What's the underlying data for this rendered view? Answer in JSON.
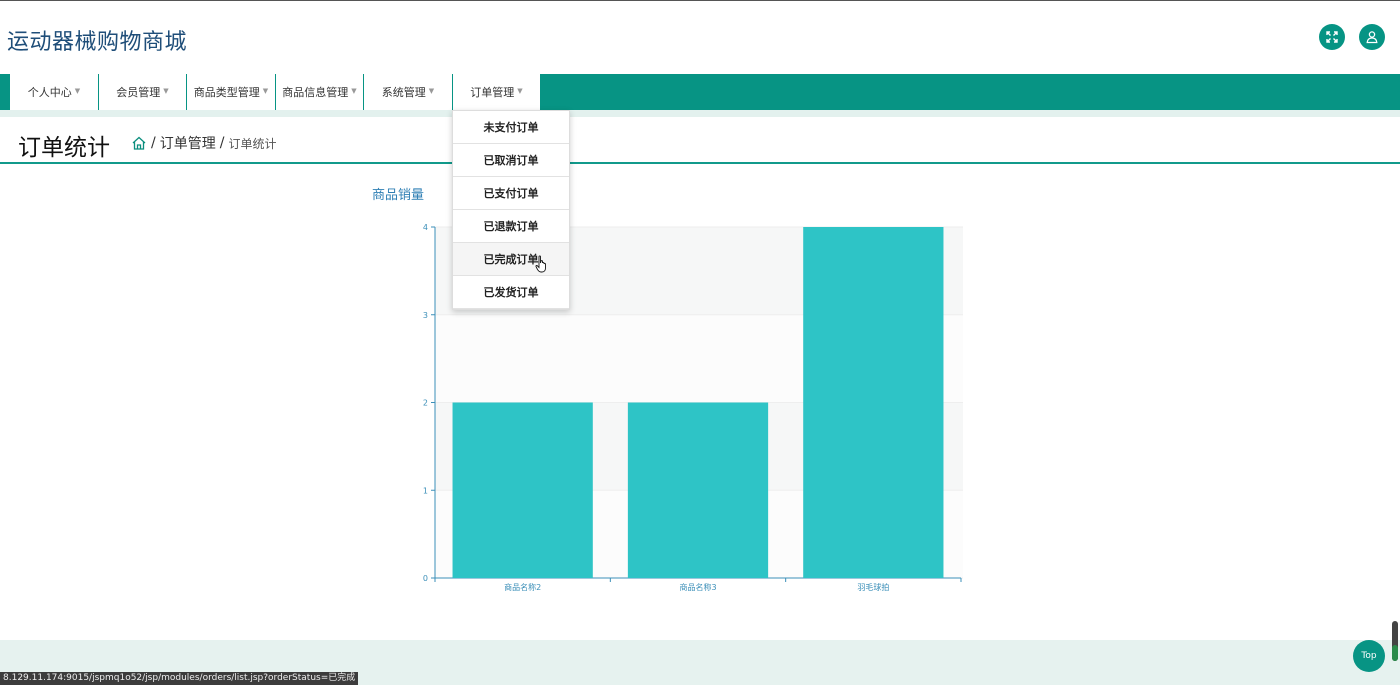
{
  "site": {
    "title": "运动器械购物商城"
  },
  "header_icons": {
    "fullscreen": "expand-icon",
    "user": "user-icon",
    "accent": "#069484"
  },
  "nav": {
    "items": [
      {
        "label": "个人中心"
      },
      {
        "label": "会员管理"
      },
      {
        "label": "商品类型管理"
      },
      {
        "label": "商品信息管理"
      },
      {
        "label": "系统管理"
      },
      {
        "label": "订单管理"
      }
    ],
    "bar_color": "#079484"
  },
  "dropdown": {
    "items": [
      {
        "label": "未支付订单"
      },
      {
        "label": "已取消订单"
      },
      {
        "label": "已支付订单"
      },
      {
        "label": "已退款订单"
      },
      {
        "label": "已完成订单"
      },
      {
        "label": "已发货订单"
      }
    ]
  },
  "page": {
    "heading": "订单统计",
    "breadcrumb": {
      "home_icon": "home-icon",
      "level1": "订单管理",
      "current": "订单统计",
      "sep": "/"
    }
  },
  "chart_data": {
    "type": "bar",
    "title": "商品销量",
    "categories": [
      "商品名称2",
      "商品名称3",
      "羽毛球拍"
    ],
    "values": [
      2,
      2,
      4
    ],
    "ylim": [
      0,
      4
    ],
    "yticks": [
      0,
      1,
      2,
      3,
      4
    ],
    "xlabel": "",
    "ylabel": "",
    "bar_color": "#2ec4c6",
    "axis_color": "#3b8fb8",
    "grid": true
  },
  "footer": {
    "status_url": "8.129.11.174:9015/jspmq1o52/jsp/modules/orders/list.jsp?orderStatus=已完成",
    "top_label": "Top"
  }
}
